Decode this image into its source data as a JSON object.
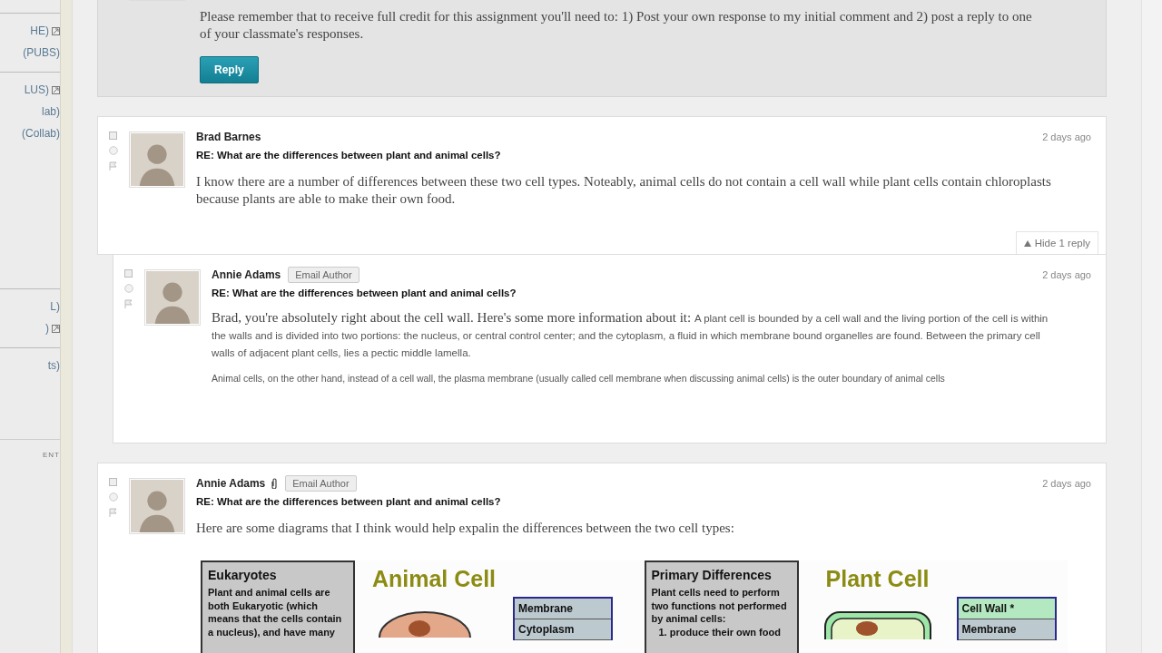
{
  "sidebar": {
    "sections": [
      {
        "items": [
          {
            "label": "HE)",
            "external": true
          },
          {
            "label": "(PUBS)",
            "external": false
          }
        ]
      },
      {
        "items": [
          {
            "label": "LUS)",
            "external": true
          },
          {
            "label": "lab)",
            "external": false
          },
          {
            "label": "(Collab)",
            "external": false
          }
        ]
      },
      {
        "items": [
          {
            "label": "L)",
            "external": false
          },
          {
            "label": ")",
            "external": true
          }
        ]
      },
      {
        "items": [
          {
            "label": "ts)",
            "external": false
          }
        ]
      },
      {
        "items": [
          {
            "label": "ENT",
            "external": false
          }
        ]
      }
    ]
  },
  "posts": [
    {
      "kind": "intro",
      "body": "Please remember that to receive full credit for this assignment you'll need to: 1) Post your own response to my initial comment and 2) post a reply to one of your classmate's responses.",
      "reply_button": "Reply"
    },
    {
      "kind": "reply",
      "checked": false,
      "author": "Brad Barnes",
      "attachment": false,
      "time": "2 days ago",
      "subject": "RE: What are the differences between plant and animal cells?",
      "body": "I know there are a number of differences between these two cell types. Noteably, animal cells do not contain a cell wall while plant cells contain chloroplasts because plants are able to make their own food.",
      "toggle": "Hide 1 reply",
      "expanded": true,
      "replies": [
        {
          "checked": false,
          "author": "Annie Adams",
          "email_button": "Email Author",
          "time": "2 days ago",
          "subject": "RE: What are the differences between plant and animal cells?",
          "lead": "Brad, you're absolutely right about the cell wall. Here's some more information about it:",
          "body": "A plant cell is bounded by a cell wall and the living portion of the cell is within the walls and is divided into two portions: the nucleus, or central control center; and the cytoplasm, a fluid in which membrane bound organelles are found. Between the primary cell walls of adjacent plant cells, lies a pectic middle lamella.",
          "body_2": "Animal cells, on the other hand,  instead of a cell wall, the plasma membrane (usually called cell membrane when discussing animal cells) is the outer boundary of animal cells"
        }
      ]
    },
    {
      "kind": "reply",
      "checked": false,
      "author": "Annie Adams",
      "attachment": true,
      "email_button": "Email Author",
      "time": "2 days ago",
      "subject": "RE: What are the differences between plant and animal cells?",
      "body": "Here are some diagrams that I think would help expalin the differences between the two cell types:",
      "diagram": {
        "panels": [
          {
            "box_title": "Eukaryotes",
            "box_text": "Plant and animal cells are both Eukaryotic (which means that the cells contain a nucleus), and have many",
            "cell_title": "Animal Cell",
            "kind": "animal",
            "labels": [
              {
                "text": "Membrane",
                "kind": "shared"
              },
              {
                "text": "Cytoplasm",
                "kind": "shared"
              }
            ]
          },
          {
            "box_title": "Primary Differences",
            "box_text": "Plant cells need to perform two functions not performed by animal cells:",
            "box_list": [
              "1. produce their own food"
            ],
            "cell_title": "Plant Cell",
            "kind": "plant",
            "labels": [
              {
                "text": "Cell Wall *",
                "kind": "unique"
              },
              {
                "text": "Membrane",
                "kind": "shared"
              }
            ]
          }
        ]
      }
    }
  ]
}
